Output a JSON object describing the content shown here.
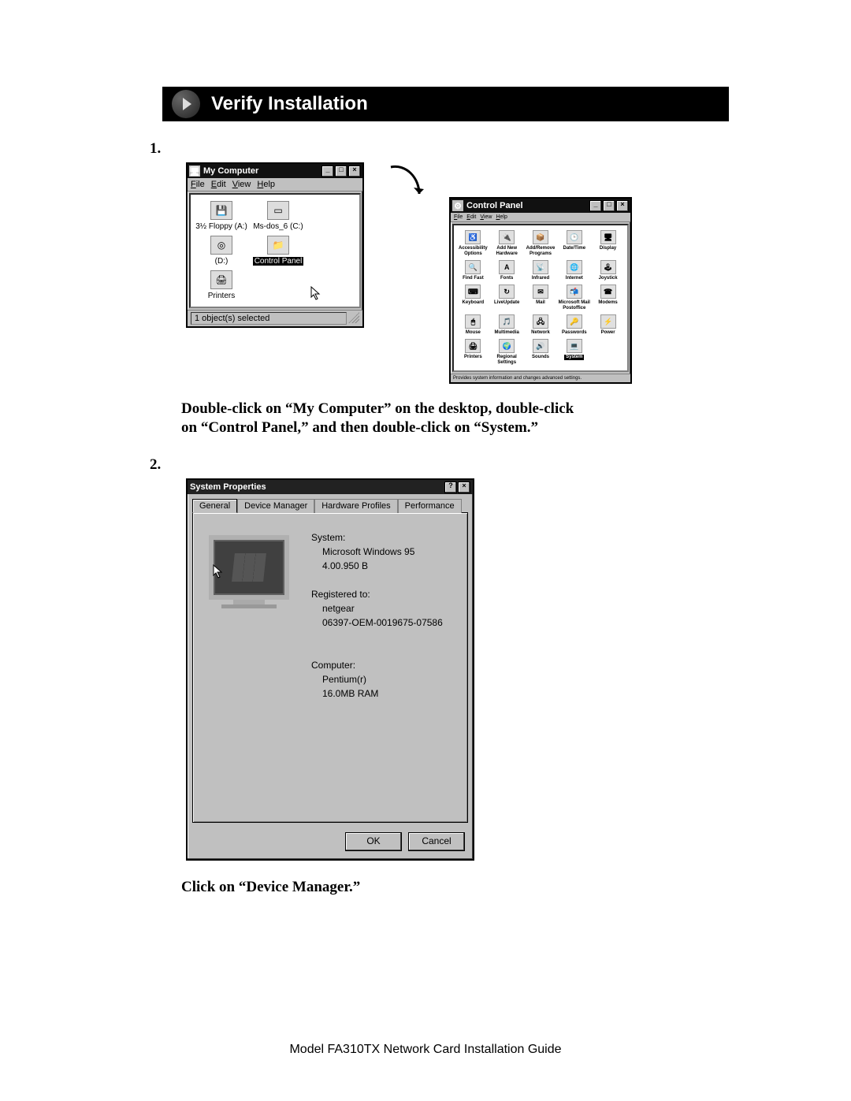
{
  "header": {
    "title": "Verify Installation"
  },
  "steps": {
    "s1": {
      "num": "1.",
      "instruction": "Double-click on “My Computer” on the desktop, double-click on “Control Panel,” and then double-click on “System.”"
    },
    "s2": {
      "num": "2.",
      "instruction": "Click on “Device Manager.”"
    }
  },
  "mycomputer": {
    "title": "My Computer",
    "menus": {
      "file": "File",
      "edit": "Edit",
      "view": "View",
      "help": "Help"
    },
    "icons": {
      "floppy": "3½ Floppy (A:)",
      "msdos": "Ms-dos_6 (C:)",
      "d": "(D:)",
      "controlpanel": "Control Panel",
      "printers": "Printers"
    },
    "status": "1 object(s) selected"
  },
  "controlpanel": {
    "title": "Control Panel",
    "menus": {
      "file": "File",
      "edit": "Edit",
      "view": "View",
      "help": "Help"
    },
    "items": [
      "Accessibility Options",
      "Add New Hardware",
      "Add/Remove Programs",
      "Date/Time",
      "Display",
      "Find Fast",
      "Fonts",
      "Infrared",
      "Internet",
      "Joystick",
      "Keyboard",
      "LiveUpdate",
      "Mail",
      "Microsoft Mail Postoffice",
      "Modems",
      "Mouse",
      "Multimedia",
      "Network",
      "Passwords",
      "Power",
      "Printers",
      "Regional Settings",
      "Sounds",
      "System"
    ],
    "selected_index": 23,
    "status": "Provides system information and changes advanced settings."
  },
  "sysprops": {
    "title": "System Properties",
    "tabs": {
      "general": "General",
      "devmgr": "Device Manager",
      "hw": "Hardware Profiles",
      "perf": "Performance"
    },
    "sys_label": "System:",
    "sys_name": "Microsoft Windows 95",
    "sys_ver": "4.00.950 B",
    "reg_label": "Registered to:",
    "reg_name": "netgear",
    "reg_key": "06397-OEM-0019675-07586",
    "comp_label": "Computer:",
    "comp_cpu": "Pentium(r)",
    "comp_ram": "16.0MB RAM",
    "ok": "OK",
    "cancel": "Cancel"
  },
  "footer": "Model FA310TX Network Card Installation Guide"
}
